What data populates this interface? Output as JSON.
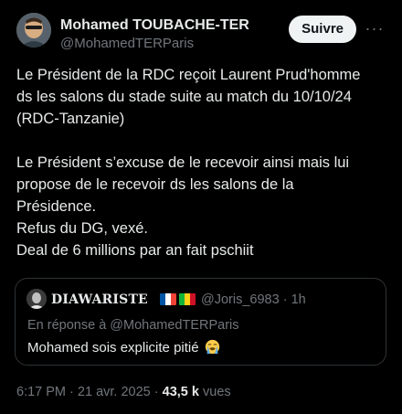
{
  "author": {
    "display_name": "Mohamed TOUBACHE-TER",
    "handle": "@MohamedTERParis"
  },
  "actions": {
    "follow_label": "Suivre",
    "more_label": "···"
  },
  "tweet": {
    "lines": [
      "Le Président de la RDC reçoit Laurent Prud'homme",
      "ds les salons du stade suite au match du 10/10/24",
      "(RDC-Tanzanie)",
      "",
      "Le Président s’excuse de le recevoir ainsi mais lui",
      "propose de le recevoir ds les salons de la",
      "Présidence.",
      "Refus du DG, vexé.",
      "Deal de 6 millions par an fait pschiit"
    ]
  },
  "quote": {
    "display_name": "DIAWARISTE",
    "flags": [
      "france-flag",
      "mali-flag"
    ],
    "handle": "@Joris_6983",
    "separator": "·",
    "age": "1h",
    "reply_to": "En réponse à @MohamedTERParis",
    "text": "Mohamed sois explicite pitié",
    "emoji": "loudly-crying-face-icon"
  },
  "meta": {
    "time": "6:17 PM",
    "separator": "·",
    "date": "21 avr. 2025",
    "views_count": "43,5 k",
    "views_label": "vues"
  },
  "colors": {
    "background": "#000000",
    "text": "#e7e9ea",
    "secondary": "#71767b",
    "border": "#2f3336",
    "follow_bg": "#eff3f4"
  }
}
